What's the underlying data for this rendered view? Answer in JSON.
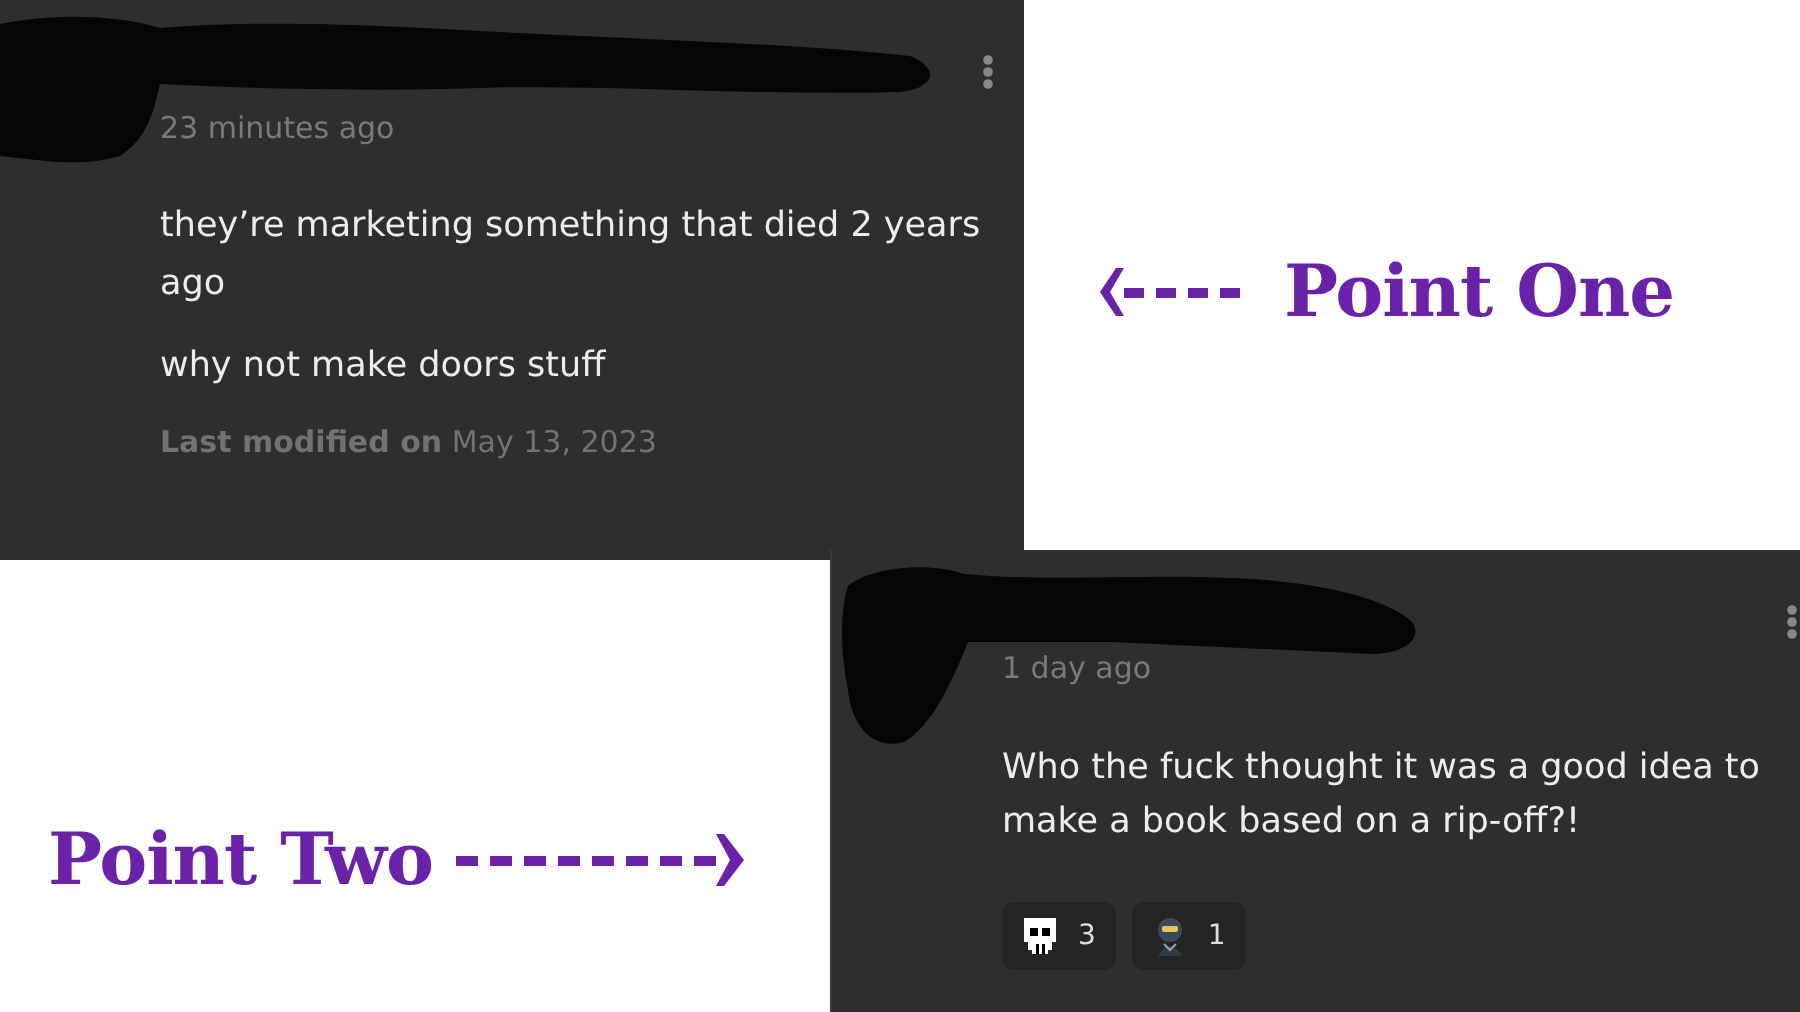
{
  "comments": [
    {
      "timestamp": "23 minutes ago",
      "paragraphs": [
        "they’re marketing something that died 2 years ago",
        "why not make doors stuff"
      ],
      "modified_label": "Last modified on",
      "modified_date": "May 13, 2023"
    },
    {
      "timestamp": "1 day ago",
      "paragraphs": [
        "Who the fuck thought it was a good idea to make a book based on a rip-off?!"
      ],
      "reactions": [
        {
          "kind": "skull",
          "count": "3"
        },
        {
          "kind": "ninja",
          "count": "1"
        }
      ]
    }
  ],
  "annotations": [
    {
      "label": "Point One",
      "kind": "left"
    },
    {
      "label": "Point Two",
      "kind": "right"
    }
  ]
}
